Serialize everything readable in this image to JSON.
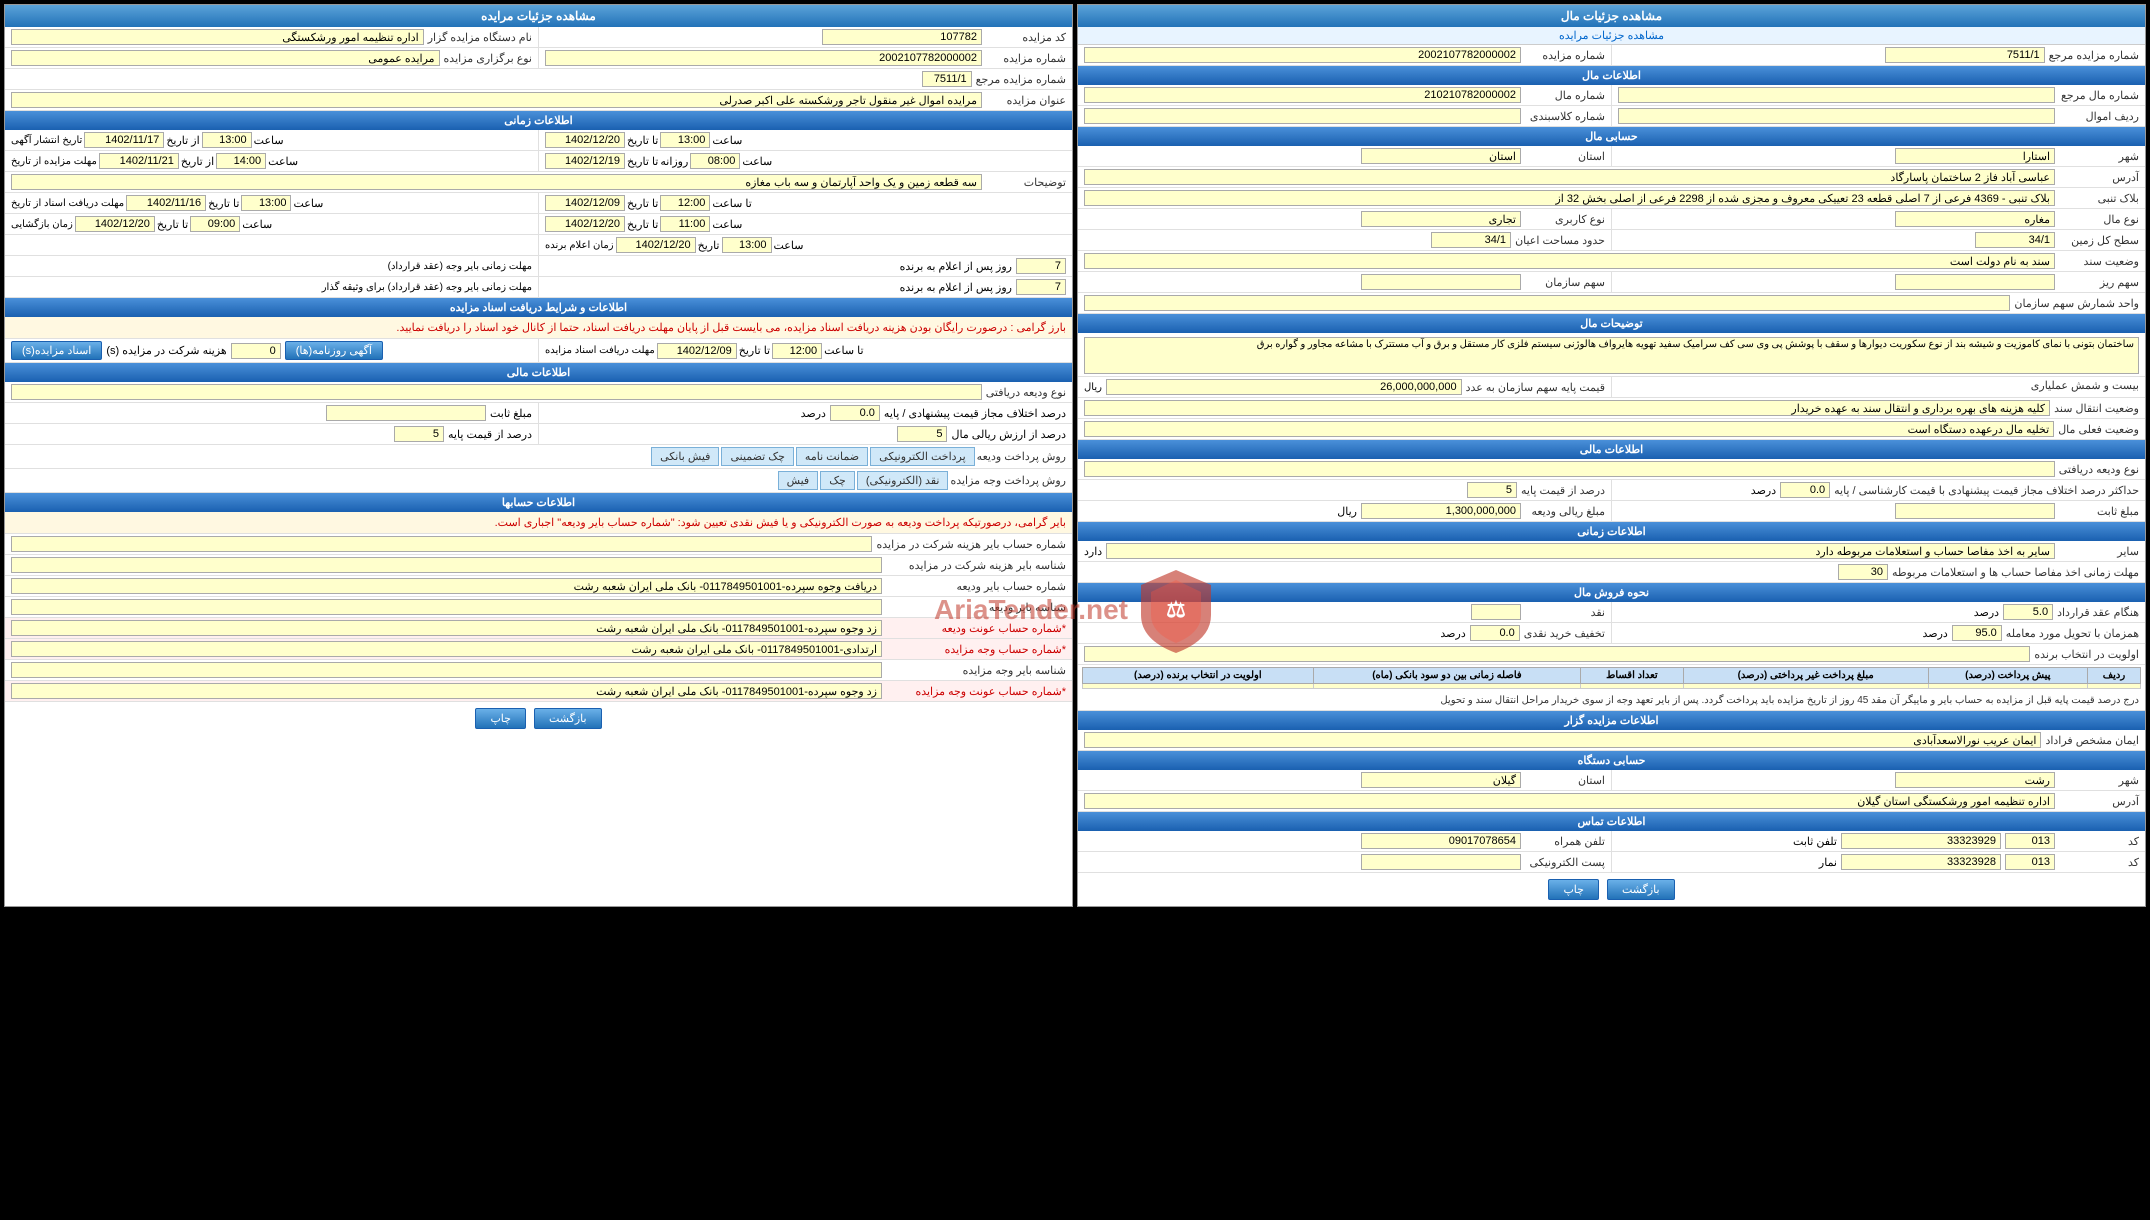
{
  "left_panel": {
    "title": "مشاهده جزئیات مال",
    "breadcrumb": "مشاهده جزئیات مرایده",
    "fields": {
      "auction_number": "2002107782000002",
      "ref_number": "7511/1",
      "auction_info_title": "اطلاعات مال",
      "mal_number": "210210782000002",
      "mal_source": "",
      "kalasbandi": "",
      "radif": "",
      "province": "استان",
      "city": "استارا",
      "address": "عباسی آباد فاز 2 ساختمان پاسارگاد",
      "block_info": "بلاک تنبی - 4369 فرعی از 7 اصلی قطعه 23 تعییکی معروف و مجزی شده از 2298 فرعی از اصلی بخش 32 از",
      "usage": "تجاری",
      "mal_type": "مغاره",
      "area_ground": "34/1",
      "area_total": "34/1",
      "document": "سند به نام دولت است",
      "shareholders": "",
      "share": "",
      "share2": "",
      "description": "ساختمان بتونی با نمای کاموزیت و شیشه بند از نوع سکوریت دیوارها و سقف با پوشش پی وی سی کف سرامیک سفید تهویه هایرواف هالوژنی سیستم فلزی کار مستقل و برق و آب مستترک با مشاعه مجاور و گواره برق",
      "price_base": "26,000,000,000",
      "price_details": "قسمت و شمش عملیاری",
      "transfer": "کلیه هزینه های بهره برداری و انتقال سند به عهده خریدار",
      "current_status": "تخلیه مال درعهده دستگاه است",
      "financial_title": "اطلاعات مالی",
      "premium_type": "نوع ودیعه دریافتی",
      "premium_amount": "1,300,000,000",
      "fixed_amount": "",
      "percent_base": "5",
      "percent_diff": "0.0",
      "time_title": "اطلاعات زمانی",
      "account_note": "سایر به اخذ مفاصا حساب و استعلامات مربوطه دارد",
      "time_limit": "30",
      "sell_title": "نحوه فروش مال",
      "cash_percent": "",
      "contract_time": "5.0",
      "transfer_buyer": "95.0",
      "discount": "0.0",
      "priority": "",
      "table_headers": [
        "ردیف",
        "پیش پرداخت (درصد)",
        "مبلغ پرداخت غیر پرداختی (درصد)",
        "تعداد اقساط",
        "فاصله زمانی بین دو سود",
        "اولویت در انتخاب برنده"
      ],
      "table_note": "درج درصد قیمت پایه قبل از مزایده به حساب بایر و ماییگر آن مقد 45 روز از تاریخ مزایده باید پرداخت گردد. پس از بایر تعهد وجه از سوی خریدار مراحل انتقال سند و تحویل",
      "contractor_title": "اطلاعات مزایده گزار",
      "contractor_agent": "ایمان عریب نورالاسعدآبادی",
      "contractor_province": "گیلان",
      "contractor_city": "رشت",
      "contractor_address": "اداره تنظیمه امور ورشکستگی استان گیلان",
      "contact_title": "اطلاعات تماس",
      "phone_fixed": "33323929",
      "phone_code1": "013",
      "fax": "33323928",
      "fax_code": "013",
      "mobile": "09017078654",
      "email": "",
      "btn_print": "چاپ",
      "btn_back": "بازگشت"
    }
  },
  "right_panel": {
    "title": "مشاهده جزئیات مرایده",
    "fields": {
      "auction_code": "107782",
      "organizer": "اداره تنظیمه امور ورشکستگی",
      "auction_type": "مرایده عمومی",
      "auction_number": "2002107782000002",
      "ref_number": "7511/1",
      "auction_subject": "مرایده اموال غیر منقول تاجر ورشکسته علی اکبر صدرلی",
      "time_title": "اطلاعات زمانی",
      "pub_from_date": "1402/11/17",
      "pub_from_time": "13:00",
      "pub_to_date": "1402/12/20",
      "pub_to_time": "09:00",
      "bid_from_date": "1402/11/21",
      "bid_from_time": "",
      "bid_to_date": "1402/12/19",
      "bid_to_time": "08:00",
      "bid_to_day": "روزانه",
      "bid_time2": "14:00",
      "description": "سه قطعه زمین و یک واحد آپارتمان و سه باب مغازه",
      "winner_time1_date": "1402/12/09",
      "winner_time1_time": "12:00",
      "winner_time2_date": "1402/11/16",
      "winner_time2_time": "13:00",
      "winner_time3_date": "1402/12/20",
      "winner_time3_time": "11:00",
      "winner_time4_date": "1402/12/20",
      "winner_time4_time": "13:00",
      "winner_contract_days": "7",
      "winner_payment_days": "7",
      "docs_title": "اطلاعات و شرایط دریافت اسناد مزایده",
      "docs_note": "بارز گرامی : درصورت رایگان بودن هزینه دریافت اسناد مزایده، می بایست قبل از پایان مهلت دریافت اسناد، حتما از کانال خود اسناد را دریافت نمایید.",
      "participants": "0",
      "receive_docs_date": "1402/12/09",
      "receive_docs_time": "12:00",
      "financial_title": "اطلاعات مالی",
      "premium_type": "نوع ودیعه دریافتی",
      "fixed_amount": "",
      "percent_base": "5",
      "percent_diff": "0.0",
      "payment_methods_label": "روش پرداخت ودیعه",
      "payment_methods": [
        "پرداخت الکترونیکی",
        "ضمانت نامه",
        "چک تضمینی",
        "فیش بانکی"
      ],
      "payment_method2_label": "روش پرداخت وجه مزایده",
      "payment_methods2": [
        "نقد (الکترونیکی)",
        "چک",
        "فیش"
      ],
      "accounts_title": "اطلاعات حسابها",
      "accounts_note": "بایر گرامی، درصورتیکه پرداخت ودیعه به صورت الکترونیکی و یا فیش نقدی تعیین شود: \"شماره حساب بایر ودیعه\" اجباری است.",
      "account1_label": "شماره حساب بایر هزینه شرکت در مزایده",
      "account1_value": "",
      "account2_label": "شناسه بایر هزینه شرکت در مزایده",
      "account2_value": "",
      "account3_label": "شماره حساب بایر ودیعه",
      "account3_value": "دریافت وجوه سپرده-0117849501001- بانک ملی ایران شعبه رشت",
      "account4_label": "شناسه بایر ودیعه",
      "account4_value": "",
      "account5_label": "*شماره حساب عونت ودیعه",
      "account5_value": "زد وجوه سپرده-0117849501001- بانک ملی ایران شعبه رشت",
      "account6_label": "*شماره حساب وجه مزایده",
      "account6_value": "ارتدادی-0117849501001- بانک ملی ایران شعبه رشت",
      "account7_label": "شناسه بایر وجه مزایده",
      "account7_value": "",
      "account8_label": "*شماره حساب عونت وجه مزایده",
      "account8_value": "زد وجوه سپرده-0117849501001- بانک ملی ایران شعبه رشت",
      "btn_print": "چاپ",
      "btn_back": "بازگشت"
    }
  },
  "watermark": {
    "text": "AriaTender.net"
  }
}
